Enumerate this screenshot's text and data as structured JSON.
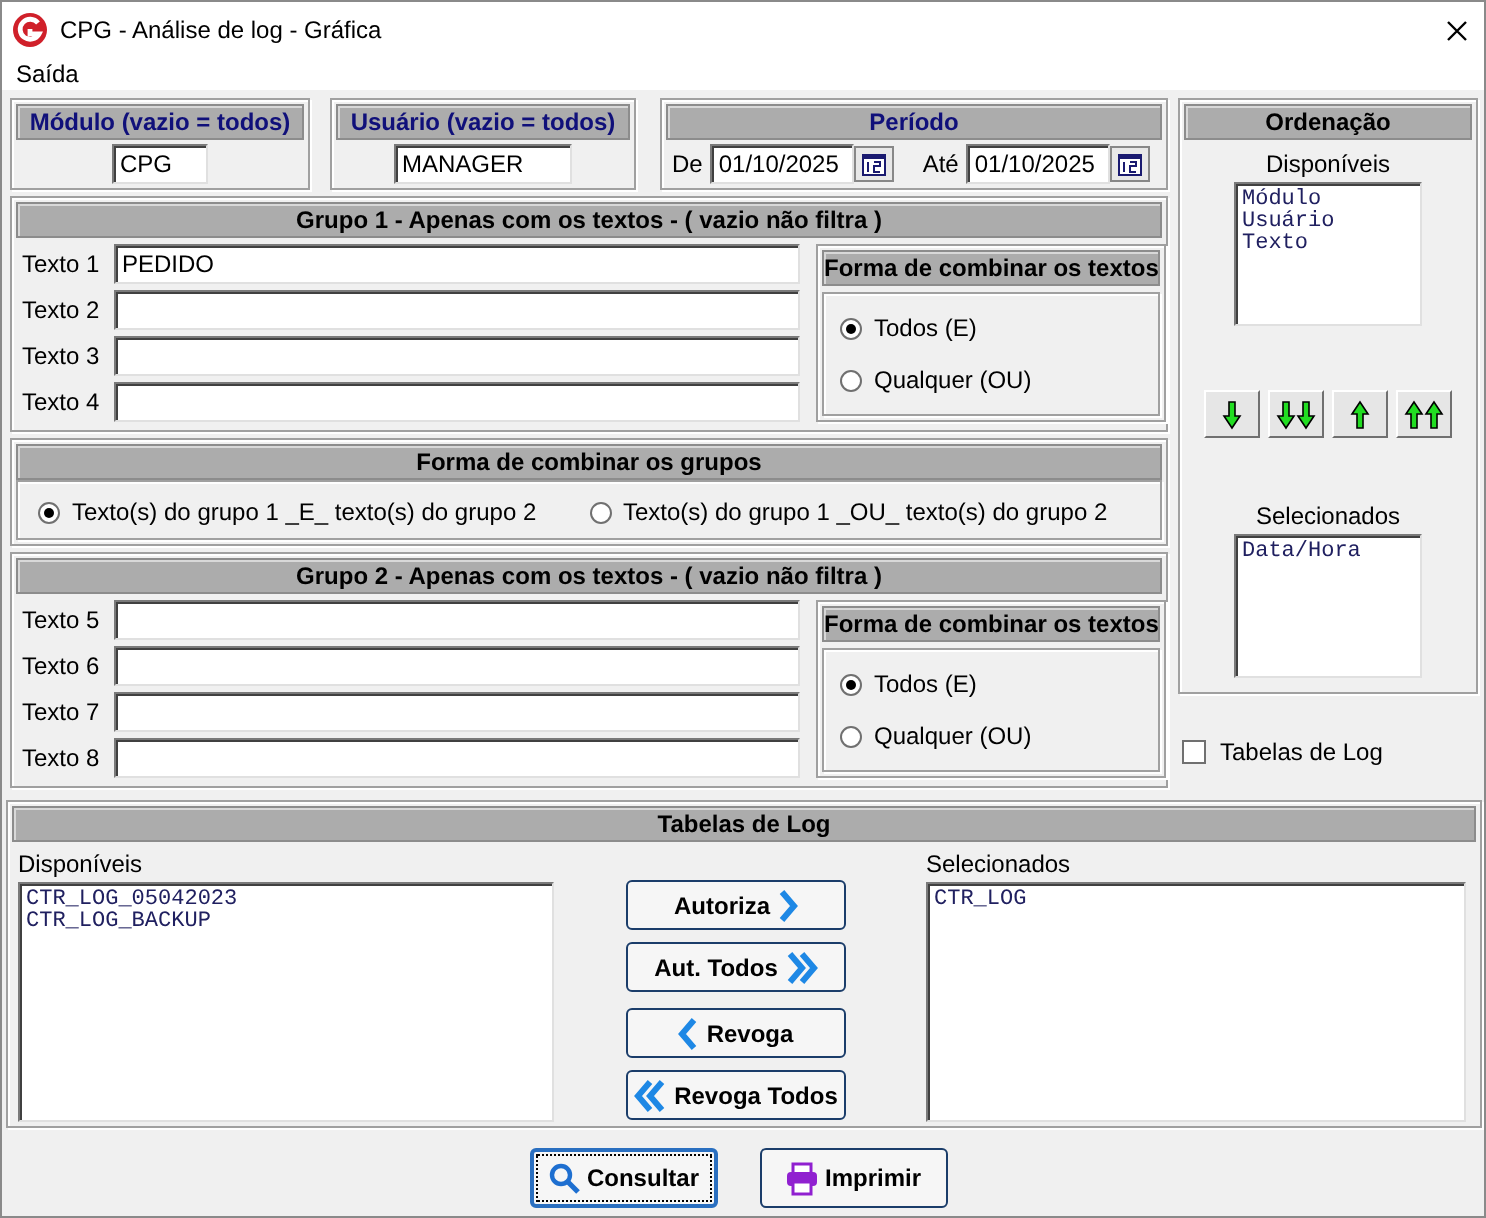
{
  "window": {
    "title": "CPG - Análise de log - Gráfica"
  },
  "menu": [
    "Saída"
  ],
  "modulo": {
    "title": "Módulo (vazio = todos)",
    "value": "CPG"
  },
  "usuario": {
    "title": "Usuário (vazio = todos)",
    "value": "MANAGER"
  },
  "periodo": {
    "title": "Período",
    "from_label": "De",
    "from": "01/10/2025",
    "to_label": "Até",
    "to": "01/10/2025"
  },
  "group1": {
    "title": "Grupo 1 - Apenas com os textos - ( vazio não filtra )",
    "fields": [
      {
        "label": "Texto 1",
        "value": "PEDIDO"
      },
      {
        "label": "Texto 2"
      },
      {
        "label": "Texto 3"
      },
      {
        "label": "Texto 4"
      }
    ],
    "combine": {
      "title": "Forma de combinar os textos",
      "options": [
        {
          "label": "Todos (E)",
          "selected": true
        },
        {
          "label": "Qualquer (OU)",
          "selected": false
        }
      ]
    }
  },
  "group_combine": {
    "title": "Forma de combinar os grupos",
    "options": [
      {
        "label": "Texto(s) do grupo 1 _E_ texto(s) do grupo 2",
        "selected": true
      },
      {
        "label": "Texto(s) do grupo 1 _OU_ texto(s) do grupo 2",
        "selected": false
      }
    ]
  },
  "group2": {
    "title": "Grupo 2 - Apenas com os textos - ( vazio não filtra )",
    "fields": [
      {
        "label": "Texto 5"
      },
      {
        "label": "Texto 6"
      },
      {
        "label": "Texto 7"
      },
      {
        "label": "Texto 8"
      }
    ],
    "combine": {
      "title": "Forma de combinar os textos",
      "options": [
        {
          "label": "Todos (E)",
          "selected": true
        },
        {
          "label": "Qualquer (OU)",
          "selected": false
        }
      ]
    }
  },
  "ordering": {
    "title": "Ordenação",
    "available_label": "Disponíveis",
    "available": [
      "Módulo",
      "Usuário",
      "Texto"
    ],
    "selected_label": "Selecionados",
    "selected_items": [
      "Data/Hora"
    ]
  },
  "log_tables_checkbox": {
    "label": "Tabelas de Log",
    "checked": false
  },
  "log_tables": {
    "title": "Tabelas de Log",
    "available_label": "Disponíveis",
    "available": [
      "CTR_LOG_05042023",
      "CTR_LOG_BACKUP"
    ],
    "selected_label": "Selecionados",
    "selected_items": [
      "CTR_LOG"
    ],
    "buttons": [
      {
        "label": "Autoriza",
        "kind": "add"
      },
      {
        "label": "Aut. Todos",
        "kind": "add_all"
      },
      {
        "label": "Revoga",
        "kind": "remove"
      },
      {
        "label": "Revoga Todos",
        "kind": "remove_all"
      }
    ]
  },
  "actions": [
    {
      "label": "Consultar",
      "kind": "search",
      "focused": true
    },
    {
      "label": "Imprimir",
      "kind": "print",
      "focused": false
    }
  ]
}
